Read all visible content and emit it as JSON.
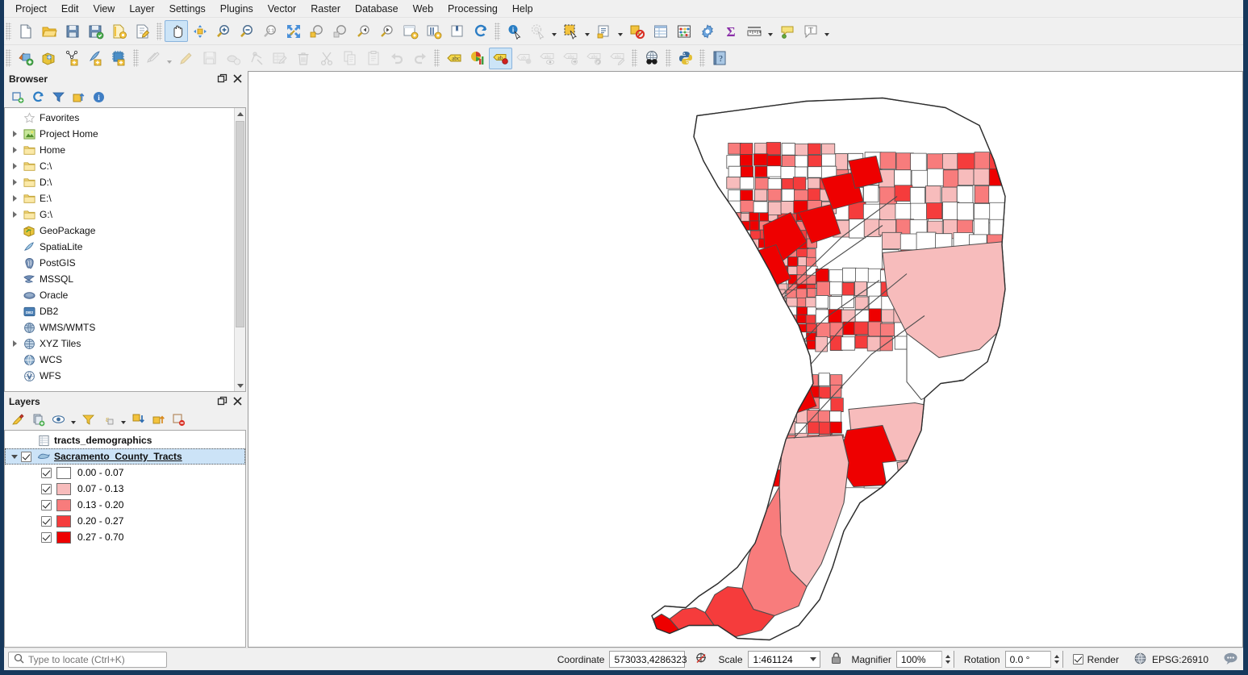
{
  "menu": {
    "items": [
      {
        "label": "Project"
      },
      {
        "label": "Edit"
      },
      {
        "label": "View"
      },
      {
        "label": "Layer"
      },
      {
        "label": "Settings"
      },
      {
        "label": "Plugins"
      },
      {
        "label": "Vector"
      },
      {
        "label": "Raster"
      },
      {
        "label": "Database"
      },
      {
        "label": "Web"
      },
      {
        "label": "Processing"
      },
      {
        "label": "Help"
      }
    ]
  },
  "toolbar_top": {
    "groups": [
      {
        "buttons": [
          {
            "name": "new-project-icon",
            "tooltip": "New Project"
          },
          {
            "name": "open-project-icon",
            "tooltip": "Open Project"
          },
          {
            "name": "save-project-icon",
            "tooltip": "Save Project"
          },
          {
            "name": "save-project-as-icon",
            "tooltip": "Save Project As"
          },
          {
            "name": "new-print-layout-icon",
            "tooltip": "New Print Layout"
          },
          {
            "name": "layout-manager-icon",
            "tooltip": "Layout Manager"
          }
        ]
      },
      {
        "buttons": [
          {
            "name": "pan-map-icon",
            "tooltip": "Pan Map",
            "state": "active"
          },
          {
            "name": "pan-to-selection-icon",
            "tooltip": "Pan Map to Selection"
          },
          {
            "name": "zoom-in-icon",
            "tooltip": "Zoom In"
          },
          {
            "name": "zoom-out-icon",
            "tooltip": "Zoom Out"
          },
          {
            "name": "zoom-native-icon",
            "tooltip": "Zoom to Native Resolution"
          },
          {
            "name": "zoom-full-icon",
            "tooltip": "Zoom Full"
          },
          {
            "name": "zoom-to-selection-icon",
            "tooltip": "Zoom to Selection"
          },
          {
            "name": "zoom-to-layer-icon",
            "tooltip": "Zoom to Layer"
          },
          {
            "name": "zoom-last-icon",
            "tooltip": "Zoom Last"
          },
          {
            "name": "zoom-next-icon",
            "tooltip": "Zoom Next"
          },
          {
            "name": "new-map-view-icon",
            "tooltip": "New Map View"
          },
          {
            "name": "new-3d-map-view-icon",
            "tooltip": "New 3D Map View"
          },
          {
            "name": "show-bookmarks-icon",
            "tooltip": "Show Bookmarks"
          },
          {
            "name": "refresh-icon",
            "tooltip": "Refresh"
          }
        ]
      },
      {
        "buttons": [
          {
            "name": "identify-features-icon",
            "tooltip": "Identify Features"
          },
          {
            "name": "select-by-radius-icon",
            "tooltip": "Select Features by Radius",
            "menu": true
          },
          {
            "name": "select-features-icon",
            "tooltip": "Select Features",
            "menu": true
          },
          {
            "name": "select-by-expression-icon",
            "tooltip": "Select by Expression",
            "menu": true
          },
          {
            "name": "deselect-features-icon",
            "tooltip": "Deselect Features"
          },
          {
            "name": "open-attribute-table-icon",
            "tooltip": "Open Attribute Table"
          },
          {
            "name": "field-calculator-icon",
            "tooltip": "Field Calculator"
          },
          {
            "name": "processing-toolbox-icon",
            "tooltip": "Processing Toolbox"
          },
          {
            "name": "statistical-summary-icon",
            "tooltip": "Statistical Summary"
          },
          {
            "name": "measure-line-icon",
            "tooltip": "Measure Line",
            "menu": true
          },
          {
            "name": "map-tips-icon",
            "tooltip": "Show Map Tips"
          },
          {
            "name": "text-annotation-icon",
            "tooltip": "Text Annotation",
            "menu": true
          }
        ]
      }
    ]
  },
  "toolbar_second": {
    "groups": [
      {
        "buttons": [
          {
            "name": "add-vector-layer-icon",
            "tooltip": "Add Vector Layer"
          },
          {
            "name": "add-database-layer-icon",
            "tooltip": "Add Database Layer"
          },
          {
            "name": "new-shapefile-layer-icon",
            "tooltip": "New Shapefile Layer"
          },
          {
            "name": "new-spatialite-layer-icon",
            "tooltip": "New SpatiaLite Layer"
          },
          {
            "name": "new-memory-layer-icon",
            "tooltip": "New Temporary Scratch Layer"
          }
        ]
      },
      {
        "buttons": [
          {
            "name": "current-edits-icon",
            "tooltip": "Current Edits",
            "state": "disabled",
            "menu": true
          },
          {
            "name": "toggle-editing-icon",
            "tooltip": "Toggle Editing",
            "state": "disabled"
          },
          {
            "name": "save-layer-edits-icon",
            "tooltip": "Save Layer Edits",
            "state": "disabled"
          },
          {
            "name": "add-feature-icon",
            "tooltip": "Add Feature",
            "state": "disabled"
          },
          {
            "name": "vertex-tool-icon",
            "tooltip": "Vertex Tool",
            "state": "disabled"
          },
          {
            "name": "modify-attributes-icon",
            "tooltip": "Modify Attributes of Features",
            "state": "disabled"
          },
          {
            "name": "delete-selected-icon",
            "tooltip": "Delete Selected",
            "state": "disabled"
          },
          {
            "name": "cut-features-icon",
            "tooltip": "Cut Features",
            "state": "disabled"
          },
          {
            "name": "copy-features-icon",
            "tooltip": "Copy Features",
            "state": "disabled"
          },
          {
            "name": "paste-features-icon",
            "tooltip": "Paste Features",
            "state": "disabled"
          },
          {
            "name": "undo-icon",
            "tooltip": "Undo",
            "state": "disabled"
          },
          {
            "name": "redo-icon",
            "tooltip": "Redo",
            "state": "disabled"
          }
        ]
      },
      {
        "buttons": [
          {
            "name": "label-layer-icon",
            "tooltip": "Layer Labeling Options"
          },
          {
            "name": "diagram-layer-icon",
            "tooltip": "Layer Diagram Options"
          },
          {
            "name": "pin-labels-icon",
            "tooltip": "Pin/Unpin Labels and Diagrams",
            "state": "active"
          },
          {
            "name": "highlight-pinned-labels-icon",
            "tooltip": "Highlight Pinned Labels",
            "state": "disabled"
          },
          {
            "name": "show-hide-labels-icon",
            "tooltip": "Show/Hide Labels and Diagrams",
            "state": "disabled"
          },
          {
            "name": "move-label-icon",
            "tooltip": "Move a Label or Diagram",
            "state": "disabled"
          },
          {
            "name": "rotate-label-icon",
            "tooltip": "Rotate a Label",
            "state": "disabled"
          },
          {
            "name": "change-label-icon",
            "tooltip": "Change Label",
            "state": "disabled"
          }
        ]
      },
      {
        "buttons": [
          {
            "name": "metasearch-icon",
            "tooltip": "MetaSearch"
          }
        ]
      },
      {
        "buttons": [
          {
            "name": "python-console-icon",
            "tooltip": "Python Console"
          }
        ]
      },
      {
        "buttons": [
          {
            "name": "help-icon",
            "tooltip": "Help"
          }
        ]
      }
    ]
  },
  "browser_panel": {
    "title": "Browser",
    "float_button": "float-panel-icon",
    "close_button": "close-panel-icon",
    "toolbar": [
      {
        "name": "add-selected-layers-icon",
        "tooltip": "Add Selected Layers"
      },
      {
        "name": "refresh-browser-icon",
        "tooltip": "Refresh"
      },
      {
        "name": "filter-browser-icon",
        "tooltip": "Filter Browser"
      },
      {
        "name": "collapse-all-icon",
        "tooltip": "Collapse All"
      },
      {
        "name": "properties-icon",
        "tooltip": "Properties"
      }
    ],
    "items": [
      {
        "label": "Favorites",
        "icon": "star-icon",
        "expandable": false
      },
      {
        "label": "Project Home",
        "icon": "project-home-icon",
        "expandable": true
      },
      {
        "label": "Home",
        "icon": "folder-icon",
        "expandable": true
      },
      {
        "label": "C:\\",
        "icon": "folder-icon",
        "expandable": true
      },
      {
        "label": "D:\\",
        "icon": "folder-icon",
        "expandable": true
      },
      {
        "label": "E:\\",
        "icon": "folder-icon",
        "expandable": true
      },
      {
        "label": "G:\\",
        "icon": "folder-icon",
        "expandable": true
      },
      {
        "label": "GeoPackage",
        "icon": "geopackage-icon",
        "expandable": false
      },
      {
        "label": "SpatiaLite",
        "icon": "spatialite-icon",
        "expandable": false
      },
      {
        "label": "PostGIS",
        "icon": "postgis-icon",
        "expandable": false
      },
      {
        "label": "MSSQL",
        "icon": "mssql-icon",
        "expandable": false
      },
      {
        "label": "Oracle",
        "icon": "oracle-icon",
        "expandable": false
      },
      {
        "label": "DB2",
        "icon": "db2-icon",
        "expandable": false
      },
      {
        "label": "WMS/WMTS",
        "icon": "wms-icon",
        "expandable": false
      },
      {
        "label": "XYZ Tiles",
        "icon": "xyz-tiles-icon",
        "expandable": true
      },
      {
        "label": "WCS",
        "icon": "wcs-icon",
        "expandable": false
      },
      {
        "label": "WFS",
        "icon": "wfs-icon",
        "expandable": false
      }
    ]
  },
  "layers_panel": {
    "title": "Layers",
    "float_button": "float-panel-icon",
    "close_button": "close-panel-icon",
    "toolbar": [
      {
        "name": "open-layer-styling-icon",
        "tooltip": "Open the Layer Styling panel"
      },
      {
        "name": "add-group-icon",
        "tooltip": "Add Group"
      },
      {
        "name": "manage-layer-visibility-icon",
        "tooltip": "Manage Map Themes",
        "menu": true
      },
      {
        "name": "filter-legend-icon",
        "tooltip": "Filter Legend by Map Content"
      },
      {
        "name": "filter-legend-expression-icon",
        "tooltip": "Filter Legend by Expression",
        "menu": true
      },
      {
        "name": "expand-all-icon",
        "tooltip": "Expand All"
      },
      {
        "name": "collapse-all-icon",
        "tooltip": "Collapse All"
      },
      {
        "name": "remove-layer-icon",
        "tooltip": "Remove Layer/Group"
      }
    ],
    "layers": [
      {
        "name": "tracts_demographics",
        "icon": "attribute-table-icon",
        "has_checkbox": false,
        "selected": false,
        "expandable": false
      },
      {
        "name": "Sacramento_County_Tracts",
        "icon": "polygon-layer-icon",
        "has_checkbox": true,
        "checked": true,
        "selected": true,
        "expandable": true,
        "expanded": true,
        "symbology": [
          {
            "label": "0.00 - 0.07",
            "color": "#FFFFFF",
            "checked": true
          },
          {
            "label": "0.07 - 0.13",
            "color": "#F7BCBC",
            "checked": true
          },
          {
            "label": "0.13 - 0.20",
            "color": "#F87C7C",
            "checked": true
          },
          {
            "label": "0.20 - 0.27",
            "color": "#F53C3C",
            "checked": true
          },
          {
            "label": "0.27 - 0.70",
            "color": "#EE0000",
            "checked": true
          }
        ]
      }
    ]
  },
  "map": {
    "layer_name": "Sacramento_County_Tracts",
    "background": "#FFFFFF",
    "outline_color": "#4d4d4d",
    "classes": [
      "#FFFFFF",
      "#F7BCBC",
      "#F87C7C",
      "#F53C3C",
      "#EE0000"
    ]
  },
  "statusbar": {
    "locator_placeholder": "Type to locate (Ctrl+K)",
    "locator_icon": "search-icon",
    "coordinate_label": "Coordinate",
    "coordinate_value": "573033,4286323",
    "coordinate_toggle_icon": "coordinate-capture-icon",
    "scale_label": "Scale",
    "scale_value": "1:461124",
    "scale_lock_icon": "lock-icon",
    "magnifier_label": "Magnifier",
    "magnifier_value": "100%",
    "rotation_label": "Rotation",
    "rotation_value": "0.0 °",
    "render_label": "Render",
    "render_checked": true,
    "crs_icon": "crs-globe-icon",
    "crs_value": "EPSG:26910",
    "messages_icon": "messages-icon"
  }
}
